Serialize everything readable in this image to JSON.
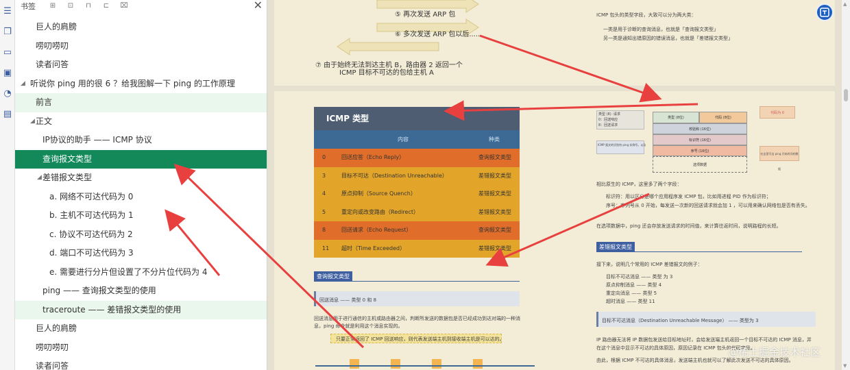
{
  "panel": {
    "title": "书签",
    "toolbar": [
      "add-bookmark-icon",
      "expand-icon",
      "bookmark-icon",
      "bookmark-outline-icon",
      "trash-icon"
    ]
  },
  "tree": [
    {
      "label": "巨人的肩膀",
      "indent": 1,
      "state": ""
    },
    {
      "label": "唠叨唠叨",
      "indent": 1,
      "state": ""
    },
    {
      "label": "读者问答",
      "indent": 1,
      "state": ""
    },
    {
      "label": "听说你 ping 用的很 6 ？给我图解一下 ping 的工作原理",
      "indent": 0,
      "state": "",
      "caret": "◢"
    },
    {
      "label": "前言",
      "indent": 1,
      "state": "light"
    },
    {
      "label": "正文",
      "indent": 1,
      "state": "",
      "caret": "◢"
    },
    {
      "label": "IP协议的助手 —— ICMP 协议",
      "indent": 2,
      "state": ""
    },
    {
      "label": "查询报文类型",
      "indent": 2,
      "state": "active"
    },
    {
      "label": "差错报文类型",
      "indent": 2,
      "state": "",
      "caret": "◢"
    },
    {
      "label": "a. 网络不可达代码为 0",
      "indent": 3,
      "state": ""
    },
    {
      "label": "b. 主机不可达代码为 1",
      "indent": 3,
      "state": ""
    },
    {
      "label": "c. 协议不可达代码为 2",
      "indent": 3,
      "state": ""
    },
    {
      "label": "d. 端口不可达代码为 3",
      "indent": 3,
      "state": ""
    },
    {
      "label": "e. 需要进行分片但设置了不分片位代码为 4",
      "indent": 3,
      "state": ""
    },
    {
      "label": "ping —— 查询报文类型的使用",
      "indent": 2,
      "state": ""
    },
    {
      "label": "traceroute —— 差错报文类型的使用",
      "indent": 2,
      "state": "light"
    },
    {
      "label": "巨人的肩膀",
      "indent": 1,
      "state": ""
    },
    {
      "label": "唠叨唠叨",
      "indent": 1,
      "state": ""
    },
    {
      "label": "读者问答",
      "indent": 1,
      "state": ""
    }
  ],
  "doc": {
    "step5": "⑤ 再次发送 ARP 包",
    "step6": "⑥ 多次发送 ARP 包以后......",
    "step7a": "⑦ 由于始终无法到达主机 B，路由器 2 返回一个",
    "step7b": "ICMP 目标不可达的包给主机 A",
    "right_intro": "ICMP 包头的类型字段，大致可以分为两大类：",
    "right_b1": "一类是用于诊断的查询消息，也就是「查询报文类型」",
    "right_b2": "另一类是通知出错原因的错误消息，也就是「差错报文类型」",
    "compare": "相比原生的 ICMP，这里多了两个字段：",
    "field1": "标识符：用以区分是哪个应用程序发 ICMP 包，比如用进程 PID 作为标识符；",
    "field2": "序号：序列号从 0 开始，每发送一次新的回送请求就会加 1 ，可以用来确认网络包是否有丢失。",
    "option": "在选项数据中，ping 还会存放发送请求的时间值，来计算往返时间，说明路程的长短。",
    "err_tag": "差错报文类型",
    "err_intro": "接下来，说明几个常用的 ICMP 差错报文的例子：",
    "err_items": [
      "目标不可达消息 —— 类型 为 3",
      "原点抑制消息 —— 类型 4",
      "重定向消息 —— 类型 5",
      "超时消息 —— 类型 11"
    ],
    "err_bar": "目标不可达消息（Destination Unreachable Message） —— 类型为 3",
    "err_p1": "IP 路由器无法将 IP 数据包发送给目标地址时，会给发送端主机返回一个目标不可达的 ICMP 消息，并",
    "err_p2": "在这个消息中显示不可达的具体原因，原因记录在 ICMP 包头的代码字段。",
    "err_p3": "由此，根据 ICMP 不可达的具体消息，发送端主机也就可以了解此次发送不可达的具体原因。",
    "query_tag": "查询报文类型",
    "query_bar": "回送消息 —— 类型 0 和 8",
    "query_p1": "回送消息用于进行通信的主机或路由器之间，判断所发送的数据包是否已经成功到达对端的一种消",
    "query_p2": "息，ping 命令就是利用这个消息实现的。",
    "query_callout": "只要正常返回了 ICMP 回送响应，则代表发送端主机到接收端主机是可以达的。",
    "watermark": "@稀土掘金技术社区"
  },
  "packet": {
    "left_note1": "类型 (8) ·请求",
    "left_note2": "0：回送响应",
    "left_note3": "8：回送请求",
    "type": "类型 (8位)",
    "code": "代码 (8位)",
    "checksum": "校验和 (16位)",
    "id": "标识符 (16位)",
    "seq": "序号 (16位)",
    "opt": "选项数据",
    "right_note1": "代码为 0",
    "left_note4": "ICMP 报文的识别符 ping 实例号，以及",
    "right_note2": "在这里写出 ping 开始时间的数据"
  },
  "icmp_table": {
    "title": "ICMP 类型",
    "col_content": "内容",
    "col_kind": "种类",
    "rows": [
      {
        "code": "0",
        "content": "回送应答（Echo Reply）",
        "kind": "查询报文类型",
        "color": "#e06e2a"
      },
      {
        "code": "3",
        "content": "目标不可达（Destination Unreachable）",
        "kind": "差错报文类型",
        "color": "#e2a52a"
      },
      {
        "code": "4",
        "content": "原点抑制（Source Quench）",
        "kind": "差错报文类型",
        "color": "#e2a52a"
      },
      {
        "code": "5",
        "content": "重定向或改变路由（Redirect）",
        "kind": "差错报文类型",
        "color": "#e2a52a"
      },
      {
        "code": "8",
        "content": "回送请求（Echo Request）",
        "kind": "查询报文类型",
        "color": "#e06e2a"
      },
      {
        "code": "11",
        "content": "超时（Time Exceeded）",
        "kind": "差错报文类型",
        "color": "#e2a52a"
      }
    ]
  },
  "colors": {
    "active": "#13895a",
    "light": "#eaf7ec",
    "arrow": "#e8403f",
    "table_head": "#3d6a95"
  }
}
